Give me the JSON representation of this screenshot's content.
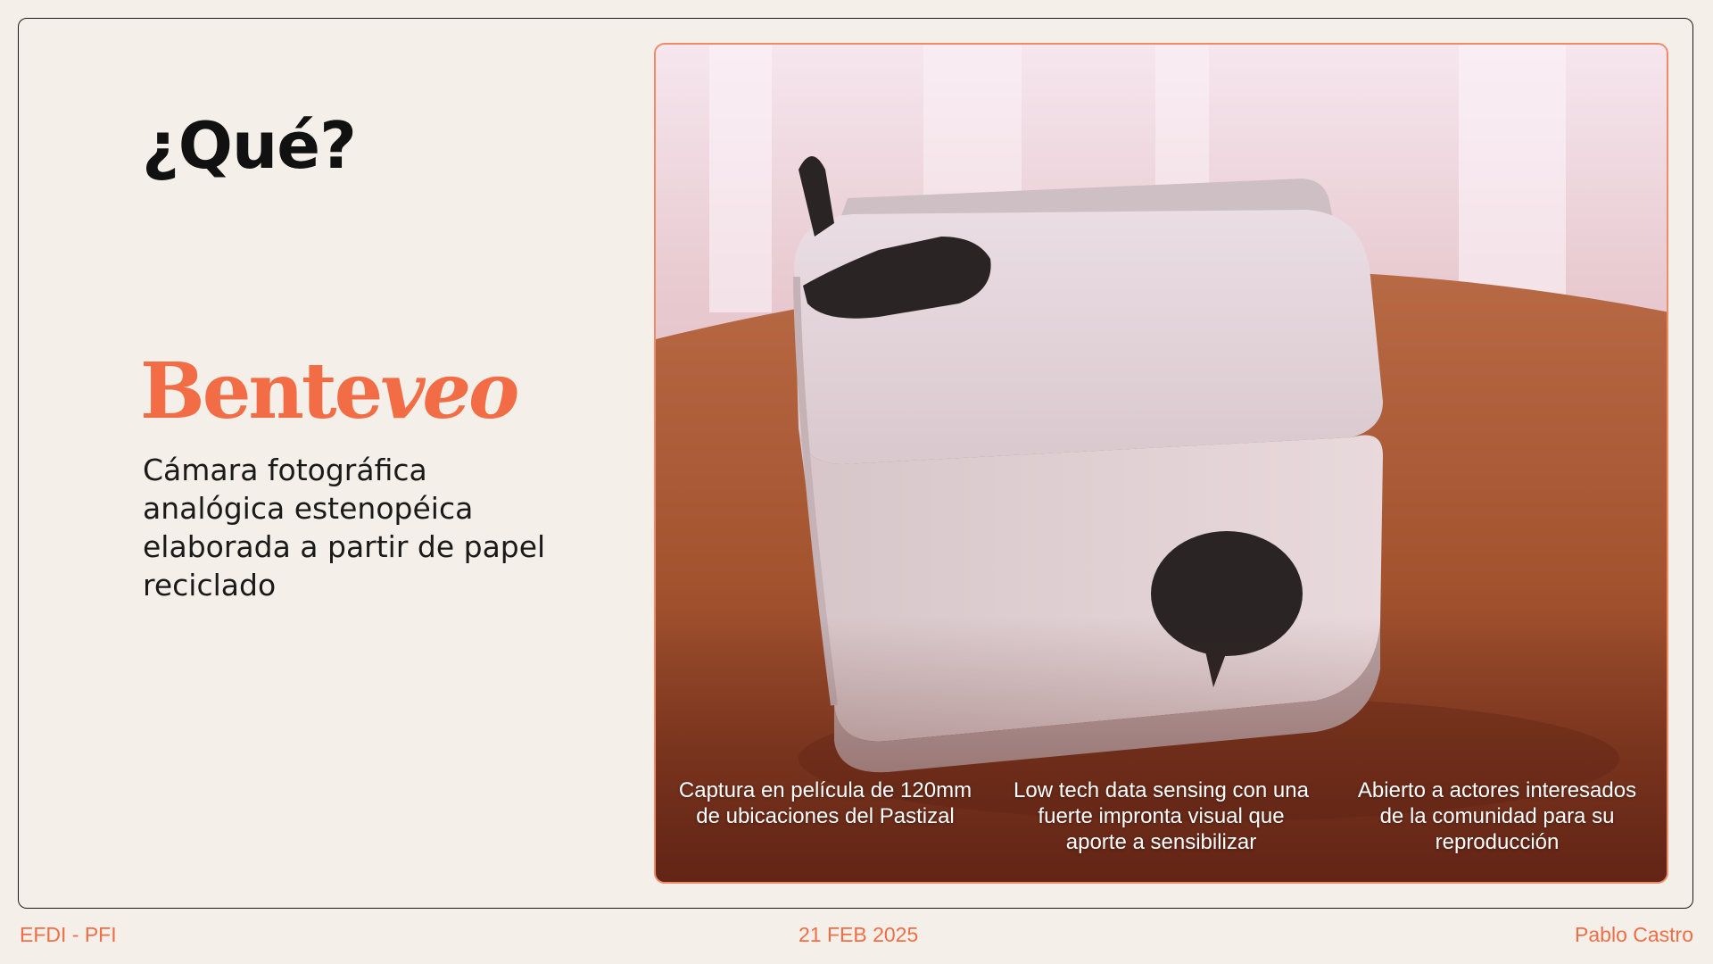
{
  "slide": {
    "heading": "¿Qué?",
    "brand": {
      "regular": "Bente",
      "italic": "veo"
    },
    "description": "Cámara fotográfica analógica estenopéica elaborada a partir de papel reciclado"
  },
  "photo": {
    "captions": [
      "Captura en película de 120mm de ubicaciones del Pastizal",
      "Low tech data sensing con una fuerte impronta visual que aporte a sensibilizar",
      "Abierto a actores interesados de la comunidad para su reproducción"
    ]
  },
  "footer": {
    "left": "EFDI - PFI",
    "center": "21 FEB 2025",
    "right": "Pablo Castro"
  },
  "colors": {
    "background": "#f4f0e9",
    "accent": "#f26d45",
    "text": "#111111"
  }
}
